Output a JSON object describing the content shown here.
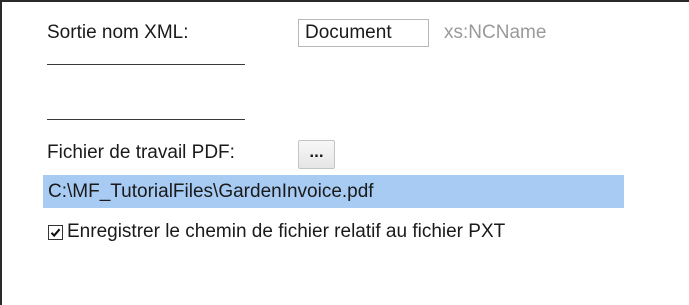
{
  "xml_output": {
    "label": "Sortie nom XML:",
    "value": "Document",
    "type_hint": "xs:NCName"
  },
  "pdf": {
    "label": "Fichier de travail PDF:",
    "browse_label": "...",
    "path": "C:\\MF_TutorialFiles\\GardenInvoice.pdf"
  },
  "relative_path": {
    "label": "Enregistrer le chemin de fichier relatif au fichier PXT",
    "checked": true
  }
}
